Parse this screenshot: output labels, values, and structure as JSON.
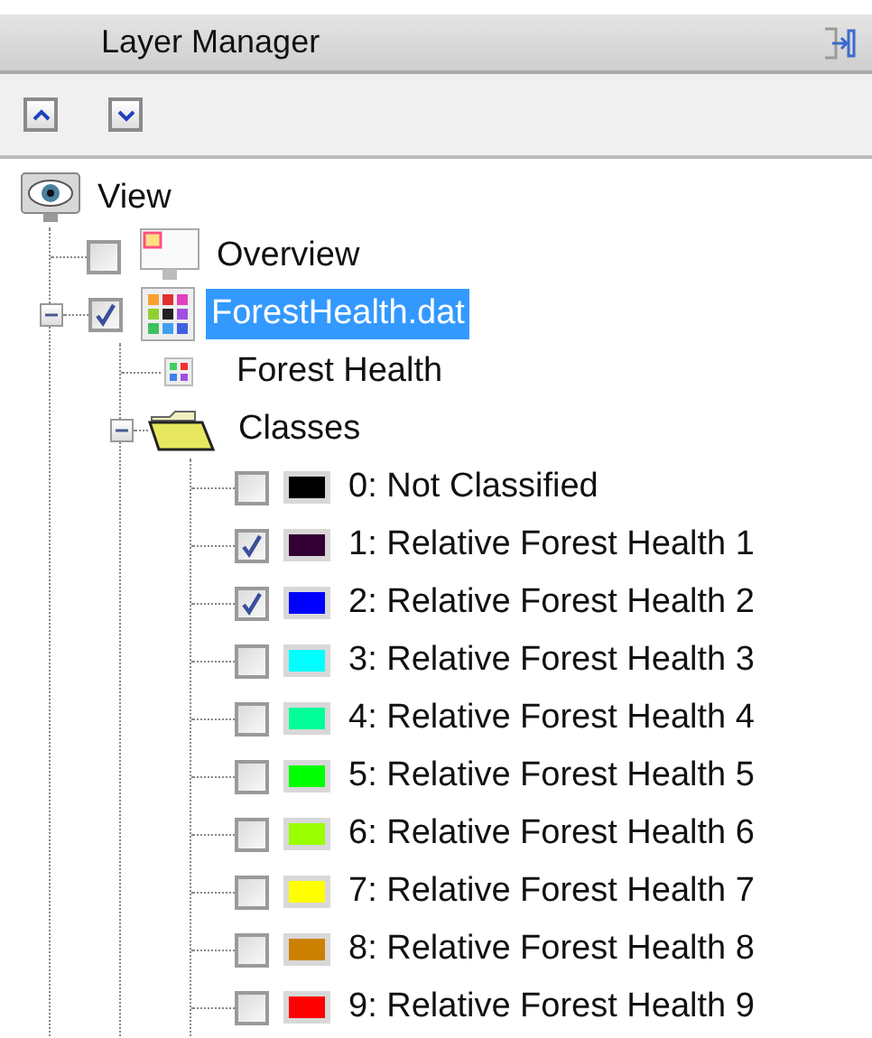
{
  "panel": {
    "title": "Layer Manager"
  },
  "toolbar": [
    {
      "kind": "up"
    },
    {
      "kind": "down"
    }
  ],
  "tree": {
    "kind": "view",
    "label": "View",
    "children": [
      {
        "kind": "overview",
        "label": "Overview",
        "checked": false,
        "selected": false
      },
      {
        "kind": "raster",
        "label": "ForestHealth.dat",
        "checked": true,
        "selected": true,
        "expanded": true,
        "children": [
          {
            "kind": "band",
            "label": "Forest Health"
          },
          {
            "kind": "folder",
            "label": "Classes",
            "expanded": true,
            "children": [
              {
                "kind": "class",
                "label": "0: Not Classified",
                "checked": false,
                "color": "#000000"
              },
              {
                "kind": "class",
                "label": "1: Relative Forest Health 1",
                "checked": true,
                "color": "#330033"
              },
              {
                "kind": "class",
                "label": "2: Relative Forest Health 2",
                "checked": true,
                "color": "#0000ff"
              },
              {
                "kind": "class",
                "label": "3: Relative Forest Health 3",
                "checked": false,
                "color": "#00ffff"
              },
              {
                "kind": "class",
                "label": "4: Relative Forest Health 4",
                "checked": false,
                "color": "#00ff99"
              },
              {
                "kind": "class",
                "label": "5: Relative Forest Health 5",
                "checked": false,
                "color": "#00ff00"
              },
              {
                "kind": "class",
                "label": "6: Relative Forest Health 6",
                "checked": false,
                "color": "#99ff00"
              },
              {
                "kind": "class",
                "label": "7: Relative Forest Health 7",
                "checked": false,
                "color": "#ffff00"
              },
              {
                "kind": "class",
                "label": "8: Relative Forest Health 8",
                "checked": false,
                "color": "#cc8000"
              },
              {
                "kind": "class",
                "label": "9: Relative Forest Health 9",
                "checked": false,
                "color": "#ff0000"
              }
            ]
          }
        ]
      }
    ]
  }
}
